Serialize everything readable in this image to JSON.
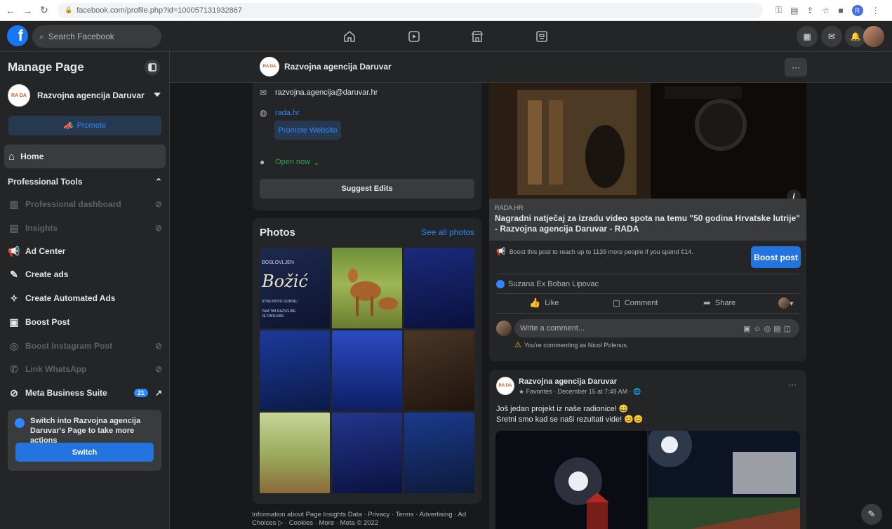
{
  "browser": {
    "url": "facebook.com/profile.php?id=100057131932867",
    "profile_initial": "R"
  },
  "topbar": {
    "search_placeholder": "Search Facebook",
    "logo": "f"
  },
  "sidebar": {
    "title": "Manage Page",
    "page_name": "Razvojna agencija Daruvar",
    "avatar_text": "RA DA",
    "promote_label": "Promote",
    "home_label": "Home",
    "professional_tools_label": "Professional Tools",
    "tools": [
      {
        "label": "Professional dashboard",
        "icon": "dashboard-icon",
        "enabled": false
      },
      {
        "label": "Insights",
        "icon": "insights-icon",
        "enabled": false
      },
      {
        "label": "Ad Center",
        "icon": "megaphone-icon",
        "enabled": true
      },
      {
        "label": "Create ads",
        "icon": "pencil-icon",
        "enabled": true
      },
      {
        "label": "Create Automated Ads",
        "icon": "wand-icon",
        "enabled": true
      },
      {
        "label": "Boost Post",
        "icon": "boost-icon",
        "enabled": true
      },
      {
        "label": "Boost Instagram Post",
        "icon": "instagram-icon",
        "enabled": false
      },
      {
        "label": "Link WhatsApp",
        "icon": "whatsapp-icon",
        "enabled": false
      },
      {
        "label": "Meta Business Suite",
        "icon": "meta-icon",
        "enabled": true,
        "badge": "21"
      }
    ],
    "switch_text": "Switch into Razvojna agencija Daruvar's Page to take more actions",
    "switch_button": "Switch"
  },
  "page_header": {
    "name": "Razvojna agencija Daruvar",
    "avatar_text": "RA DA",
    "more_label": "···"
  },
  "about": {
    "email": "razvojna.agencija@daruvar.hr",
    "website": "rada.hr",
    "promote_website": "Promote Website",
    "open_status": "Open now",
    "suggest_edits": "Suggest Edits"
  },
  "photos": {
    "title": "Photos",
    "see_all": "See all photos",
    "first_photo_top": "BOSLOVLJEN",
    "first_photo_word": "Božić",
    "first_photo_line1": "STNU NOVU GODINU",
    "first_photo_line2": "ZAM TIM RAZVOJNE",
    "first_photo_line3": "JE DARUVAR"
  },
  "footer": {
    "links": "Information about Page Insights Data · Privacy · Terms · Advertising · Ad Choices ▷ · Cookies · More · Meta © 2022"
  },
  "post1": {
    "domain": "RADA.HR",
    "title": "Nagradni natječaj za izradu video spota na temu \"50 godina Hrvatske lutrije\" - Razvojna agencija Daruvar - RADA",
    "boost_text": "Boost this post to reach up to 1139 more people if you spend €14.",
    "boost_button": "Boost post",
    "reactor": "Suzana Ex Boban Lipovac",
    "like": "Like",
    "comment": "Comment",
    "share": "Share",
    "comment_placeholder": "Write a comment...",
    "commenting_as": "You're commenting as Nicol Polenus."
  },
  "post2": {
    "name": "Razvojna agencija Daruvar",
    "meta": "★ Favorites · December 15 at 7:49 AM · 🌐",
    "line1": "Još jedan projekt iz naše radionice! 😀",
    "line2": "Sretni smo kad se naši rezultati vide! 😊😊",
    "more_label": "···"
  },
  "colors": {
    "background": "#18191a",
    "surface": "#242526",
    "accent": "#2374e1",
    "link": "#2d88ff"
  }
}
